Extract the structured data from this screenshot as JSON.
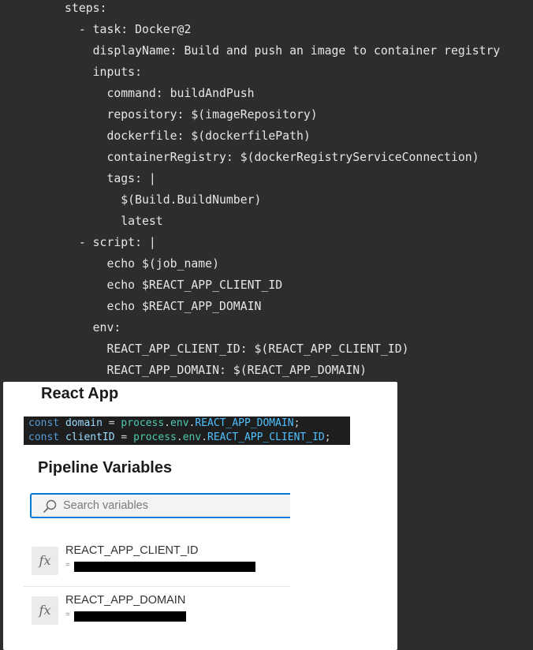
{
  "yaml": {
    "lines": [
      "steps:",
      "  - task: Docker@2",
      "    displayName: Build and push an image to container registry",
      "    inputs:",
      "      command: buildAndPush",
      "      repository: $(imageRepository)",
      "      dockerfile: $(dockerfilePath)",
      "      containerRegistry: $(dockerRegistryServiceConnection)",
      "      tags: |",
      "        $(Build.BuildNumber)",
      "        latest",
      "  - script: |",
      "      echo $(job_name)",
      "      echo $REACT_APP_CLIENT_ID",
      "      echo $REACT_APP_DOMAIN",
      "    env:",
      "      REACT_APP_CLIENT_ID: $(REACT_APP_CLIENT_ID)",
      "      REACT_APP_DOMAIN: $(REACT_APP_DOMAIN)"
    ]
  },
  "react_app": {
    "title": "React App",
    "code": [
      {
        "kw": "const",
        "var": "domain",
        "eq": "=",
        "obj": "process",
        "dot1": ".",
        "env": "env",
        "dot2": ".",
        "prop": "REACT_APP_DOMAIN",
        "end": ";"
      },
      {
        "kw": "const",
        "var": "clientID",
        "eq": "=",
        "obj": "process",
        "dot1": ".",
        "env": "env",
        "dot2": ".",
        "prop": "REACT_APP_CLIENT_ID",
        "end": ";"
      }
    ]
  },
  "pipeline_variables": {
    "title": "Pipeline Variables",
    "search_placeholder": "Search variables",
    "items": [
      {
        "icon": "fx",
        "name": "REACT_APP_CLIENT_ID",
        "value_prefix": "="
      },
      {
        "icon": "fx",
        "name": "REACT_APP_DOMAIN",
        "value_prefix": "="
      }
    ]
  }
}
